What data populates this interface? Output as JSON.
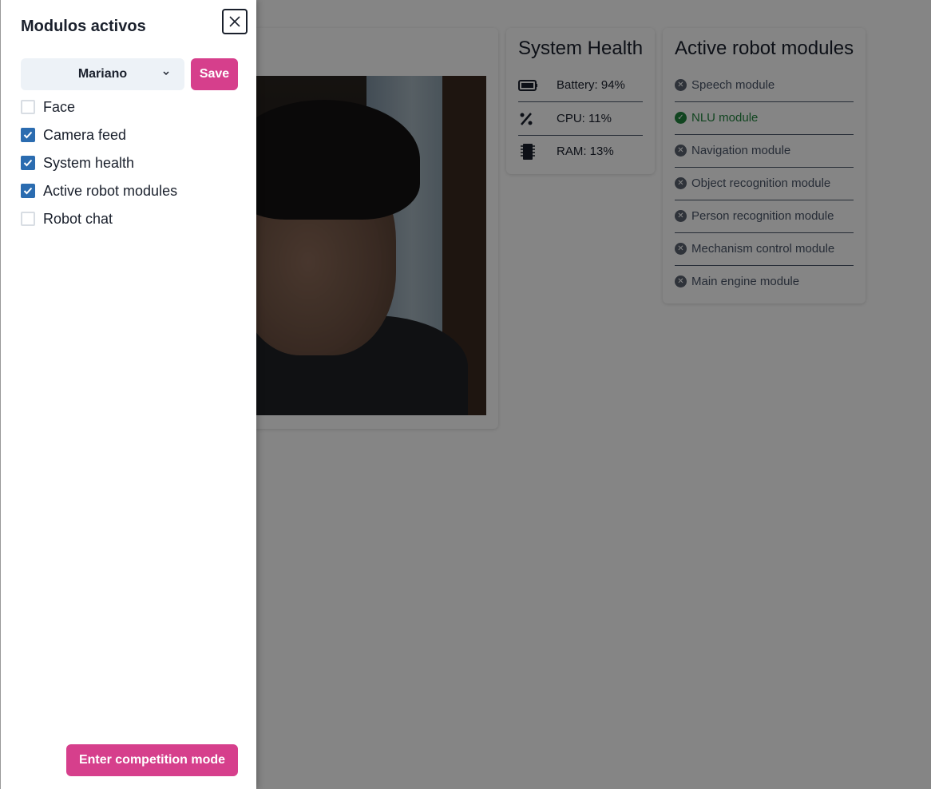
{
  "drawer": {
    "title": "Modulos activos",
    "selected_user": "Mariano",
    "save_label": "Save",
    "options": [
      {
        "label": "Face",
        "checked": false
      },
      {
        "label": "Camera feed",
        "checked": true
      },
      {
        "label": "System health",
        "checked": true
      },
      {
        "label": "Active robot modules",
        "checked": true
      },
      {
        "label": "Robot chat",
        "checked": false
      }
    ],
    "competition_label": "Enter competition mode"
  },
  "system_health": {
    "title": "System Health",
    "battery": "Battery: 94%",
    "cpu": "CPU: 11%",
    "ram": "RAM: 13%"
  },
  "robot_modules": {
    "title": "Active robot modules",
    "items": [
      {
        "label": "Speech module",
        "active": false
      },
      {
        "label": "NLU module",
        "active": true
      },
      {
        "label": "Navigation module",
        "active": false
      },
      {
        "label": "Object recognition module",
        "active": false
      },
      {
        "label": "Person recognition module",
        "active": false
      },
      {
        "label": "Mechanism control module",
        "active": false
      },
      {
        "label": "Main engine module",
        "active": false
      }
    ]
  },
  "colors": {
    "accent": "#d63f8c",
    "checkbox": "#2b6cb0",
    "active_module": "#22843f"
  }
}
